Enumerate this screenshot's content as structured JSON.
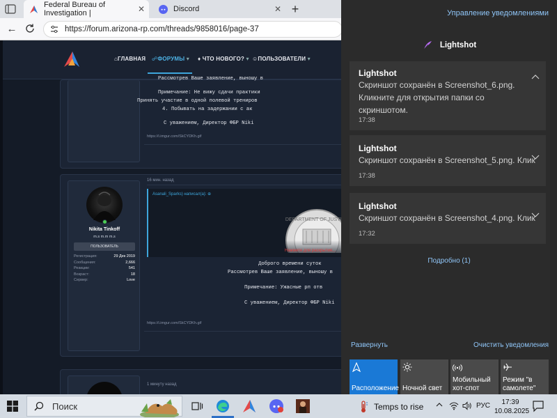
{
  "browser": {
    "tabs": [
      {
        "title": "Federal Bureau of Investigation |",
        "active": true
      },
      {
        "title": "Discord",
        "active": false
      }
    ],
    "url": "https://forum.arizona-rp.com/threads/9858016/page-37"
  },
  "forum": {
    "nav": {
      "main": "ГЛАВНАЯ",
      "forums": "ФОРУМЫ",
      "whats_new": "ЧТО НОВОГО?",
      "users": "ПОЛЬЗОВАТЕЛИ"
    },
    "post1": {
      "lines": [
        "Рассмотрев Ваше заявление, выношу в",
        "",
        "Примечание: Не вижу сдачи практики",
        "Принять участие в одной полевой трениров",
        "4. Побывать на задержании с ак",
        "",
        "С уважением, Директор ФБР Niki"
      ],
      "link": "https://i.imgur.com/SkCYDKh.gif"
    },
    "post2": {
      "time": "16 мин. назад",
      "user": {
        "name": "Nikita Tinkoff",
        "title": "m.s m.m m.s",
        "role": "ПОЛЬЗОВАТЕЛЬ",
        "stats": [
          {
            "label": "Регистрация:",
            "value": "29 Дек 2019"
          },
          {
            "label": "Сообщения:",
            "value": "2,666"
          },
          {
            "label": "Реакции:",
            "value": "541"
          },
          {
            "label": "Возраст:",
            "value": "18"
          },
          {
            "label": "Сервер:",
            "value": "Love"
          }
        ]
      },
      "quote_author": "Asanali_Sparks) написал(а):",
      "quote_expand": "Нажмите для раскрытия...",
      "lines": [
        "Доброго времени суток",
        "Рассмотрев Ваше заявление, выношу в",
        "",
        "Примечание: Ужасные рп отв",
        "",
        "С уважением, Директор ФБР Niki"
      ],
      "link": "https://i.imgur.com/SkCYDKh.gif"
    },
    "post3": {
      "time": "1 минуту назад"
    }
  },
  "notifications": {
    "manage_label": "Управление уведомлениями",
    "app_name": "Lightshot",
    "cards": [
      {
        "title": "Lightshot",
        "body": [
          "Скриншот сохранён в Screenshot_6.png.",
          "Кликните для открытия папки со",
          "скриншотом."
        ],
        "time": "17:38",
        "expanded": true
      },
      {
        "title": "Lightshot",
        "body": [
          "Скриншот сохранён в Screenshot_5.png. Клик"
        ],
        "time": "17:38",
        "expanded": false
      },
      {
        "title": "Lightshot",
        "body": [
          "Скриншот сохранён в Screenshot_4.png. Клик"
        ],
        "time": "17:32",
        "expanded": false
      }
    ],
    "more_label": "Подробно (1)",
    "expand_label": "Развернуть",
    "clear_label": "Очистить уведомления",
    "quick_actions": [
      {
        "label": "Расположение",
        "icon": "location-icon",
        "active": true
      },
      {
        "label": "Ночной свет",
        "icon": "brightness-icon",
        "active": false
      },
      {
        "label": "Мобильный\nхот-спот",
        "icon": "hotspot-icon",
        "active": false
      },
      {
        "label": "Режим \"в\nсамолете\"",
        "icon": "airplane-icon",
        "active": false
      }
    ]
  },
  "taskbar": {
    "search_placeholder": "Поиск",
    "weather": "Temps to rise",
    "language": "РУС",
    "time": "17:39",
    "date": "10.08.2025"
  },
  "colors": {
    "accent": "#1a79d6",
    "link": "#8fc5f7",
    "forum_bg": "#141b27",
    "forum_accent": "#3ea6dc",
    "expand_red": "#e03a3a"
  }
}
